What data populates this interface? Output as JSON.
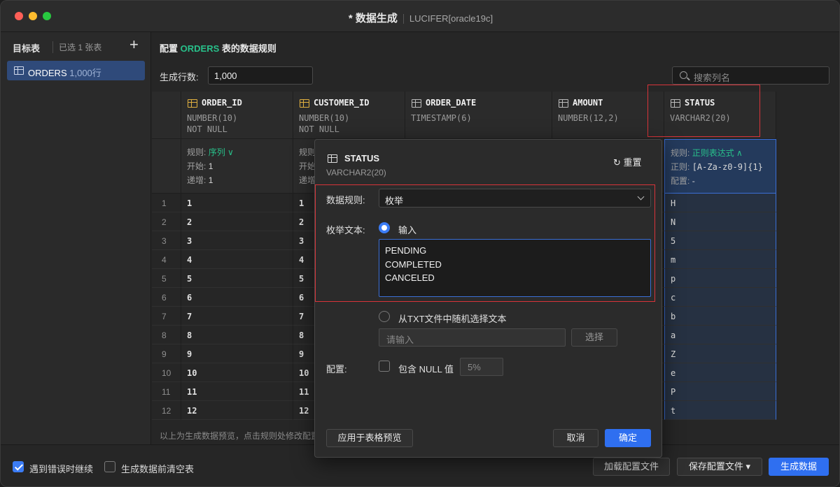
{
  "window": {
    "title": "* 数据生成",
    "connection": "LUCIFER[oracle19c]"
  },
  "sidebar": {
    "header": "目标表",
    "selected_count": "已选 1 张表",
    "add": "+",
    "items": [
      {
        "name": "ORDERS",
        "rows": "1,000行"
      }
    ]
  },
  "main": {
    "title_prefix": "配置",
    "table_name": "ORDERS",
    "title_suffix": "表的数据规则",
    "rows_label": "生成行数:",
    "rows_value": "1,000",
    "search_placeholder": "搜索列名",
    "columns": [
      {
        "name": "ORDER_ID",
        "type": "NUMBER(10)",
        "constraint": "NOT NULL",
        "rule_label": "规则:",
        "rule": "序列 ∨",
        "l2": "开始:",
        "v2": "1",
        "l3": "递增:",
        "v3": "1"
      },
      {
        "name": "CUSTOMER_ID",
        "type": "NUMBER(10)",
        "constraint": "NOT NULL",
        "rule_label": "规则",
        "rule": "",
        "l2": "开始",
        "v2": "",
        "l3": "递增",
        "v3": ""
      },
      {
        "name": "ORDER_DATE",
        "type": "TIMESTAMP(6)",
        "constraint": ""
      },
      {
        "name": "AMOUNT",
        "type": "NUMBER(12,2)",
        "constraint": ""
      },
      {
        "name": "STATUS",
        "type": "VARCHAR2(20)",
        "constraint": "",
        "rule_label": "规则:",
        "rule": "正则表达式 ∧",
        "l2": "正则:",
        "v2": "[A-Za-z0-9]{1}",
        "l3": "配置:",
        "v3": "-"
      }
    ],
    "row_numbers": [
      "1",
      "2",
      "3",
      "4",
      "5",
      "6",
      "7",
      "8",
      "9",
      "10",
      "11",
      "12"
    ],
    "order_ids": [
      "1",
      "2",
      "3",
      "4",
      "5",
      "6",
      "7",
      "8",
      "9",
      "10",
      "11",
      "12"
    ],
    "customer_ids": [
      "1",
      "2",
      "3",
      "4",
      "5",
      "6",
      "7",
      "8",
      "9",
      "10",
      "11",
      "12"
    ],
    "statuses": [
      "H",
      "N",
      "5",
      "m",
      "p",
      "c",
      "b",
      "a",
      "Z",
      "e",
      "P",
      "t"
    ],
    "footer_note": "以上为生成数据预览，点击规则处修改配置"
  },
  "popup": {
    "column": "STATUS",
    "type": "VARCHAR2(20)",
    "reset": "重置",
    "rule_label": "数据规则:",
    "rule_value": "枚举",
    "enum_label": "枚举文本:",
    "input_option": "输入",
    "enum_lines": [
      "PENDING",
      "COMPLETED",
      "CANCELED"
    ],
    "file_option": "从TXT文件中随机选择文本",
    "file_placeholder": "请输入",
    "choose": "选择",
    "config_label": "配置:",
    "null_label": "包含 NULL 值",
    "null_pct": "5%",
    "apply": "应用于表格预览",
    "cancel": "取消",
    "ok": "确定"
  },
  "bottom": {
    "continue_on_error": "遇到错误时继续",
    "truncate_before": "生成数据前清空表",
    "load_config": "加载配置文件",
    "save_config": "保存配置文件 ▾",
    "generate": "生成数据"
  },
  "colors": {
    "accent": "#2f6ff0",
    "table_green": "#28c08a",
    "highlight_red": "#d9343a"
  }
}
